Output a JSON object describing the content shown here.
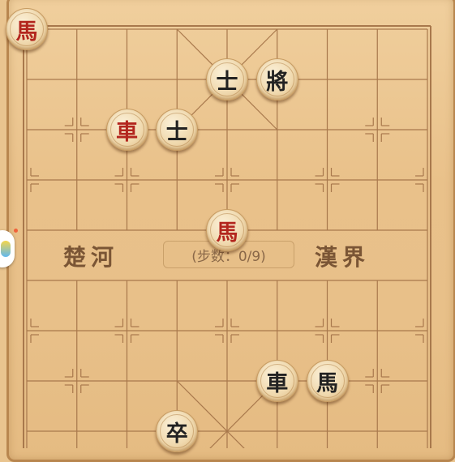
{
  "board": {
    "river_left": "楚河",
    "river_right": "漢界",
    "steps_text": "(步数：0/9)"
  },
  "pieces": [
    {
      "id": "red-horse-top",
      "char": "馬",
      "side": "red",
      "col": 0,
      "row": 0
    },
    {
      "id": "black-advisor-upper",
      "char": "士",
      "side": "black",
      "col": 4,
      "row": 1
    },
    {
      "id": "black-general",
      "char": "將",
      "side": "black",
      "col": 5,
      "row": 1
    },
    {
      "id": "red-chariot",
      "char": "車",
      "side": "red",
      "col": 2,
      "row": 2
    },
    {
      "id": "black-advisor-lower",
      "char": "士",
      "side": "black",
      "col": 3,
      "row": 2
    },
    {
      "id": "red-horse-center",
      "char": "馬",
      "side": "red",
      "col": 4,
      "row": 4
    },
    {
      "id": "black-chariot",
      "char": "車",
      "side": "black",
      "col": 5,
      "row": 7
    },
    {
      "id": "black-horse",
      "char": "馬",
      "side": "black",
      "col": 6,
      "row": 7
    },
    {
      "id": "black-soldier",
      "char": "卒",
      "side": "black",
      "col": 3,
      "row": 8
    }
  ],
  "colors": {
    "board": "#e9c48f",
    "lines": "#a8784c",
    "red_piece_text": "#b3261e",
    "black_piece_text": "#222222"
  }
}
